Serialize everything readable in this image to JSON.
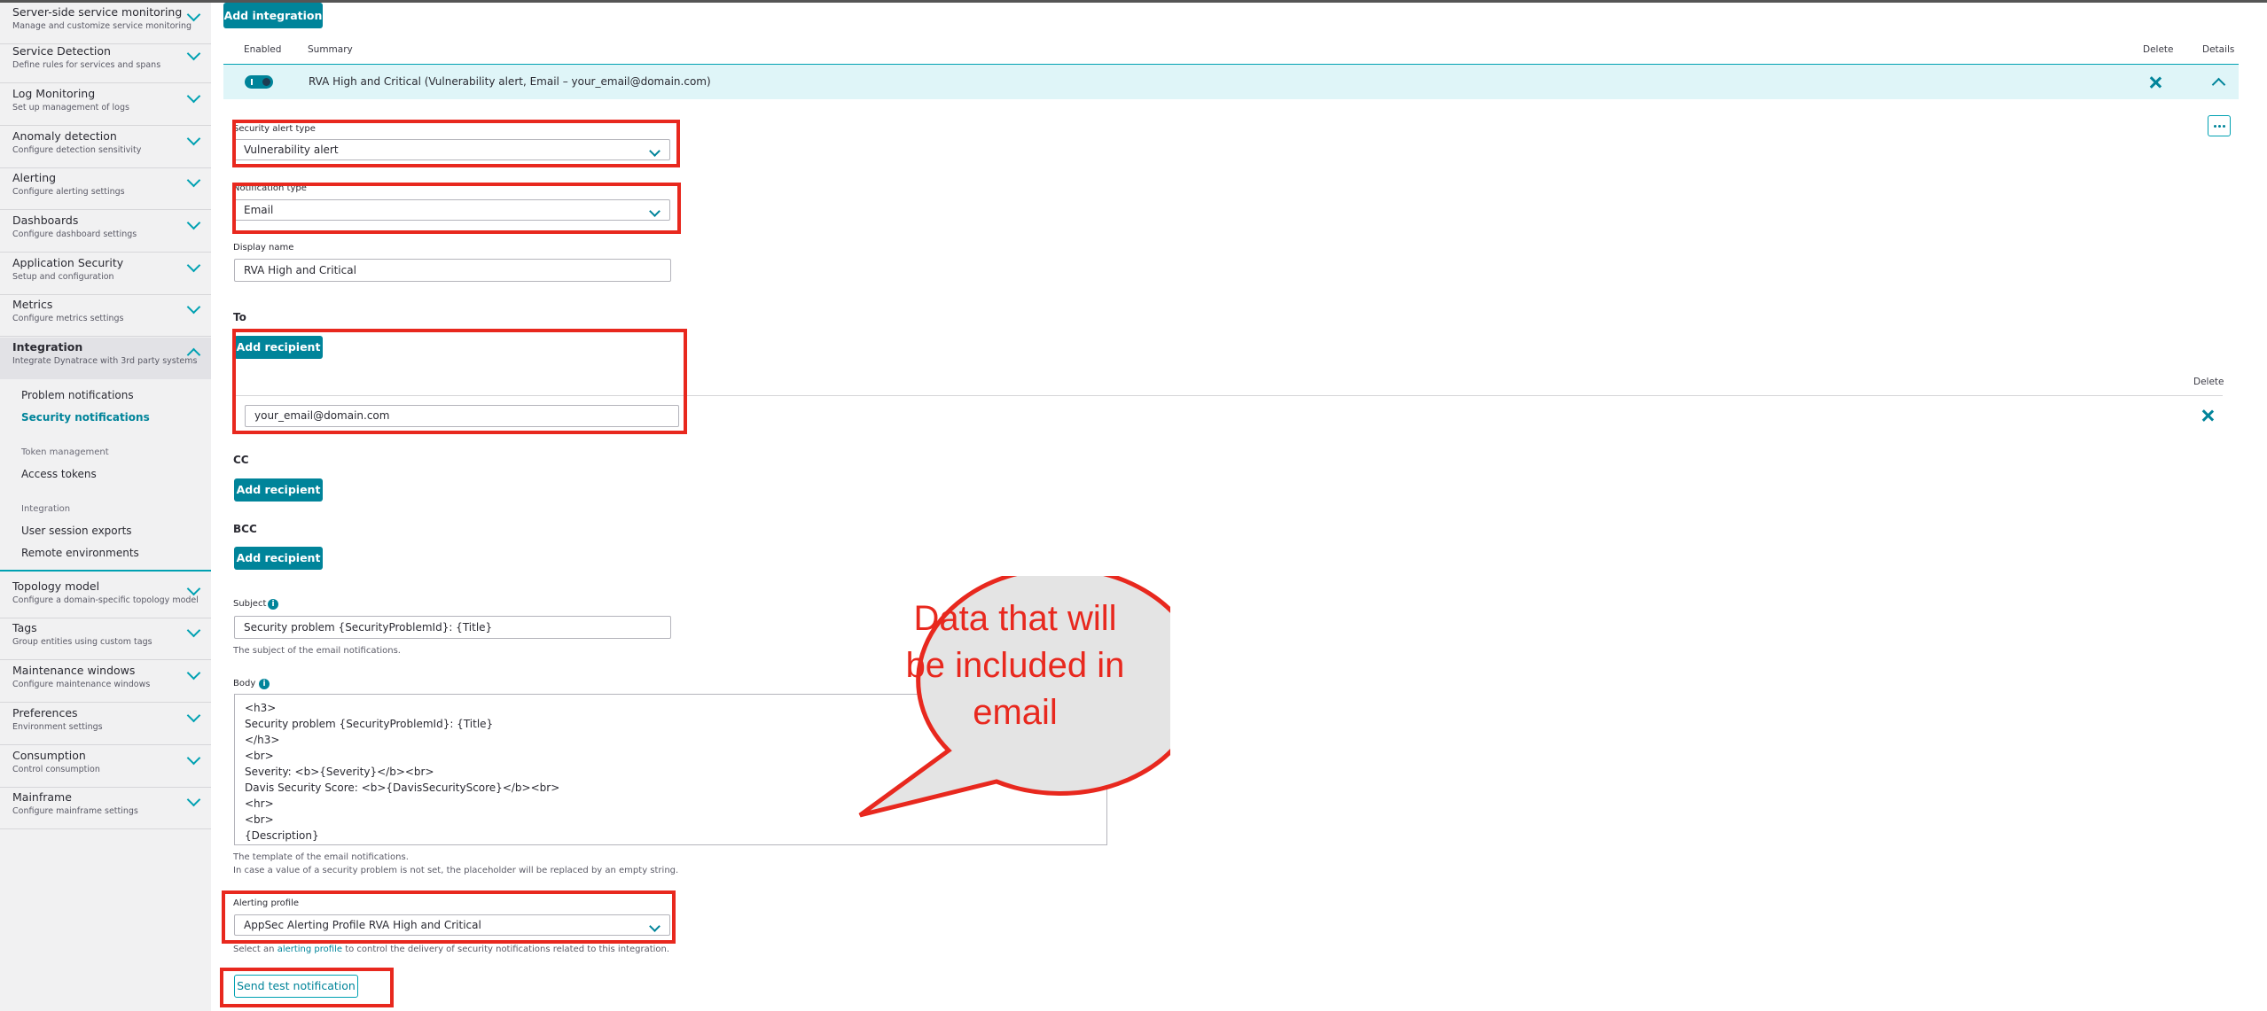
{
  "sidebar": {
    "sections": [
      {
        "title": "Server-side service monitoring",
        "subtitle": "Manage and customize service monitoring"
      },
      {
        "title": "Service Detection",
        "subtitle": "Define rules for services and spans"
      },
      {
        "title": "Log Monitoring",
        "subtitle": "Set up management of logs"
      },
      {
        "title": "Anomaly detection",
        "subtitle": "Configure detection sensitivity"
      },
      {
        "title": "Alerting",
        "subtitle": "Configure alerting settings"
      },
      {
        "title": "Dashboards",
        "subtitle": "Configure dashboard settings"
      },
      {
        "title": "Application Security",
        "subtitle": "Setup and configuration"
      },
      {
        "title": "Metrics",
        "subtitle": "Configure metrics settings"
      },
      {
        "title": "Integration",
        "subtitle": "Integrate Dynatrace with 3rd party systems"
      }
    ],
    "integration_items": {
      "problem_notifications": "Problem notifications",
      "security_notifications": "Security notifications",
      "token_management_head": "Token management",
      "access_tokens": "Access tokens",
      "integration_head": "Integration",
      "user_session_exports": "User session exports",
      "remote_environments": "Remote environments"
    },
    "lower_sections": [
      {
        "title": "Topology model",
        "subtitle": "Configure a domain-specific topology model"
      },
      {
        "title": "Tags",
        "subtitle": "Group entities using custom tags"
      },
      {
        "title": "Maintenance windows",
        "subtitle": "Configure maintenance windows"
      },
      {
        "title": "Preferences",
        "subtitle": "Environment settings"
      },
      {
        "title": "Consumption",
        "subtitle": "Control consumption"
      },
      {
        "title": "Mainframe",
        "subtitle": "Configure mainframe settings"
      }
    ]
  },
  "main": {
    "add_integration": "Add integration",
    "columns": {
      "enabled": "Enabled",
      "summary": "Summary",
      "delete": "Delete",
      "details": "Details"
    },
    "integration_summary": "RVA High and Critical (Vulnerability alert, Email – your_email@domain.com)",
    "security_alert_type_label": "Security alert type",
    "security_alert_type_value": "Vulnerability alert",
    "notification_type_label": "Notification type",
    "notification_type_value": "Email",
    "display_name_label": "Display name",
    "display_name_value": "RVA High and Critical",
    "to_label": "To",
    "add_recipient": "Add recipient",
    "recipient_delete_header": "Delete",
    "recipient_value": "your_email@domain.com",
    "cc_label": "CC",
    "bcc_label": "BCC",
    "subject_label": "Subject",
    "subject_value": "Security problem {SecurityProblemId}: {Title}",
    "subject_help": "The subject of the email notifications.",
    "body_label": "Body",
    "body_value": "<h3>\nSecurity problem {SecurityProblemId}: {Title}\n</h3>\n<br>\nSeverity: <b>{Severity}</b><br>\nDavis Security Score: <b>{DavisSecurityScore}</b><br>\n<hr>\n<br>\n{Description}",
    "body_help_1": "The template of the email notifications.",
    "body_help_2": "In case a value of a security problem is not set, the placeholder will be replaced by an empty string.",
    "alerting_profile_label": "Alerting profile",
    "alerting_profile_value": "AppSec Alerting Profile RVA High and Critical",
    "alerting_help_pre": "Select an ",
    "alerting_help_link": "alerting profile",
    "alerting_help_post": " to control the delivery of security notifications related to this integration.",
    "send_test": "Send test notification"
  },
  "annotation": {
    "callout_text": "Data that will be included in email",
    "color": "#e8281e"
  }
}
